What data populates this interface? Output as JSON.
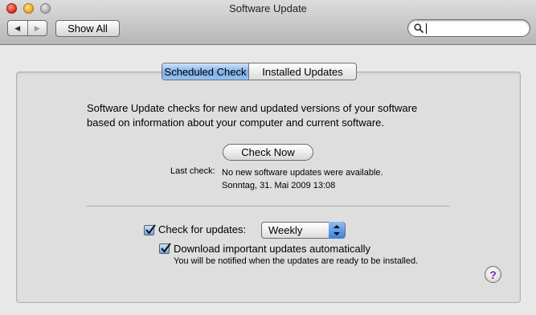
{
  "window": {
    "title": "Software Update"
  },
  "toolbar": {
    "back_icon": "chevron-left",
    "forward_icon": "chevron-right",
    "show_all_label": "Show All",
    "search": {
      "value": "",
      "placeholder": "",
      "icon": "magnifier"
    }
  },
  "tabs": [
    {
      "label": "Scheduled Check",
      "selected": true
    },
    {
      "label": "Installed Updates",
      "selected": false
    }
  ],
  "main": {
    "description_line1": "Software Update checks for new and updated versions of your software",
    "description_line2": "based on information about your computer and current software.",
    "check_now_label": "Check Now",
    "last_check_label": "Last check:",
    "last_check_result": "No new software updates were available.",
    "last_check_date": "Sonntag, 31. Mai 2009 13:08",
    "check_for_updates": {
      "label": "Check for updates:",
      "checked": true
    },
    "frequency_select": {
      "value": "Weekly"
    },
    "download_automatically": {
      "label": "Download important updates automatically",
      "checked": true
    },
    "download_note": "You will be notified when the updates are ready to be installed.",
    "help_label": "?"
  },
  "colors": {
    "selected_tab": "#7fb0ea",
    "checkbox": "#6fa3e6",
    "help_glyph": "#6a2ea8"
  }
}
